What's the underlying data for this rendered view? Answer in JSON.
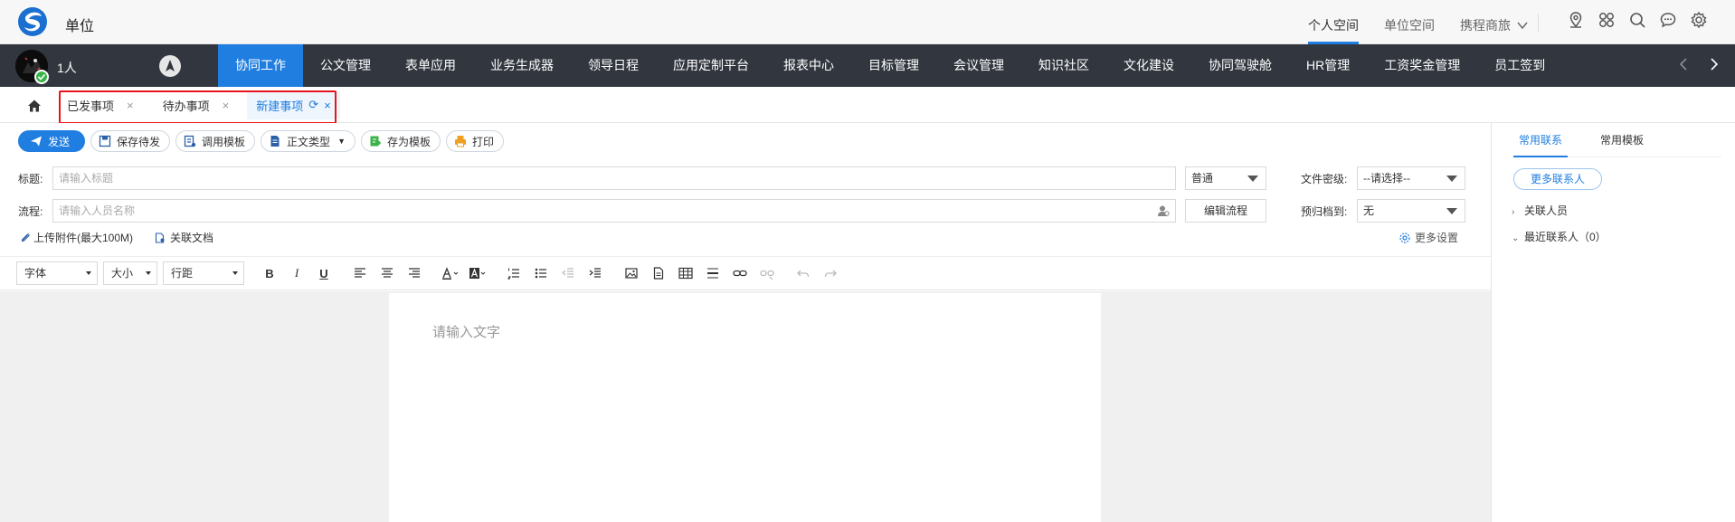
{
  "header": {
    "unit_name": "单位",
    "links": [
      "个人空间",
      "单位空间",
      "携程商旅"
    ],
    "active_link": 0
  },
  "nav": {
    "user_label": "1人",
    "items": [
      "协同工作",
      "公文管理",
      "表单应用",
      "业务生成器",
      "领导日程",
      "应用定制平台",
      "报表中心",
      "目标管理",
      "会议管理",
      "知识社区",
      "文化建设",
      "协同驾驶舱",
      "HR管理",
      "工资奖金管理",
      "员工签到"
    ],
    "active_index": 0,
    "accent_color": "#1f7ee0",
    "bg_color": "#31363f"
  },
  "tabs": {
    "items": [
      {
        "label": "已发事项"
      },
      {
        "label": "待办事项"
      },
      {
        "label": "新建事项"
      }
    ],
    "active_index": 2
  },
  "toolbar": {
    "send": "发送",
    "save_draft": "保存待发",
    "use_template": "调用模板",
    "doc_type": "正文类型",
    "save_template": "存为模板",
    "print": "打印"
  },
  "form": {
    "title_label": "标题:",
    "title_placeholder": "请输入标题",
    "priority_value": "普通",
    "secret_label": "文件密级:",
    "secret_value": "--请选择--",
    "flow_label": "流程:",
    "flow_placeholder": "请输入人员名称",
    "edit_flow": "编辑流程",
    "archive_label": "预归档到:",
    "archive_value": "无",
    "upload": "上传附件(最大100M)",
    "related_doc": "关联文档",
    "more_settings": "更多设置"
  },
  "editor": {
    "font_label": "字体",
    "size_label": "大小",
    "line_label": "行距",
    "placeholder": "请输入文字"
  },
  "right_panel": {
    "tabs": [
      "常用联系",
      "常用模板"
    ],
    "more_contacts": "更多联系人",
    "related_people": "关联人员",
    "recent_contacts": "最近联系人（0）"
  }
}
